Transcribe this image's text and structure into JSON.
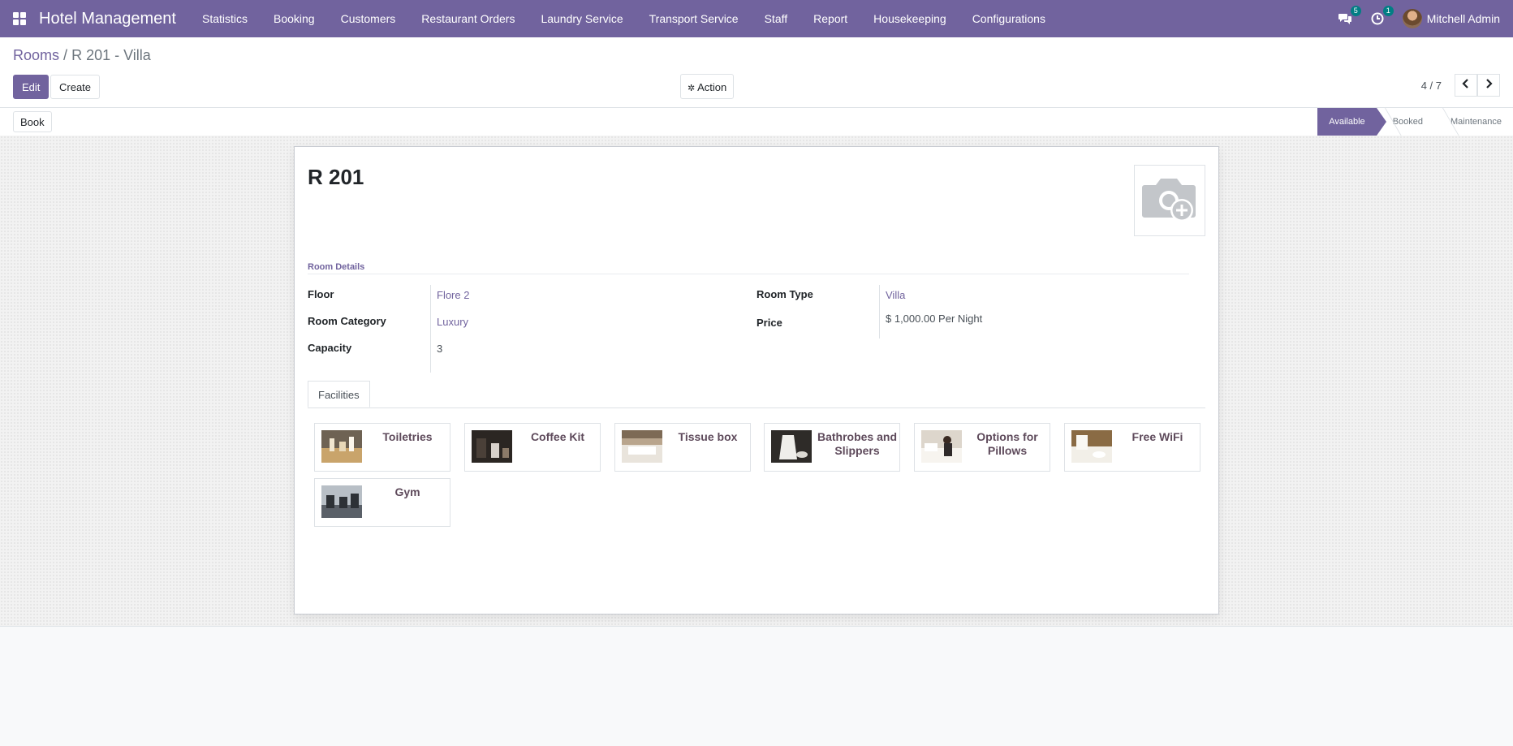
{
  "navbar": {
    "app_name": "Hotel Management",
    "menu": [
      "Statistics",
      "Booking",
      "Customers",
      "Restaurant Orders",
      "Laundry Service",
      "Transport Service",
      "Staff",
      "Report",
      "Housekeeping",
      "Configurations"
    ],
    "messages_count": "5",
    "activities_count": "1",
    "user_name": "Mitchell Admin"
  },
  "breadcrumb": {
    "parent": "Rooms",
    "separator": "/",
    "current": "R 201 - Villa"
  },
  "buttons": {
    "edit": "Edit",
    "create": "Create",
    "action": "Action",
    "book": "Book"
  },
  "pager": {
    "value": "4 / 7"
  },
  "statusbar": {
    "stages": [
      "Available",
      "Booked",
      "Maintenance"
    ],
    "active": "Available"
  },
  "record": {
    "title": "R 201",
    "section_title": "Room Details",
    "fields": {
      "floor_label": "Floor",
      "floor_value": "Flore 2",
      "category_label": "Room Category",
      "category_value": "Luxury",
      "capacity_label": "Capacity",
      "capacity_value": "3",
      "type_label": "Room Type",
      "type_value": "Villa",
      "price_label": "Price",
      "price_value": "$ 1,000.00 Per Night"
    },
    "tab_label": "Facilities",
    "facilities": [
      "Toiletries",
      "Coffee Kit",
      "Tissue box",
      "Bathrobes and Slippers",
      "Options for Pillows",
      "Free WiFi",
      "Gym"
    ]
  },
  "colors": {
    "brand": "#71639e",
    "badge": "#017e84",
    "facility_text": "#5e4a5b"
  },
  "icons": {
    "apps": "apps-grid-icon",
    "messages": "chat-icon",
    "activities": "clock-icon",
    "action": "gear-icon",
    "prev": "chevron-left-icon",
    "next": "chevron-right-icon",
    "image": "camera-plus-icon"
  }
}
